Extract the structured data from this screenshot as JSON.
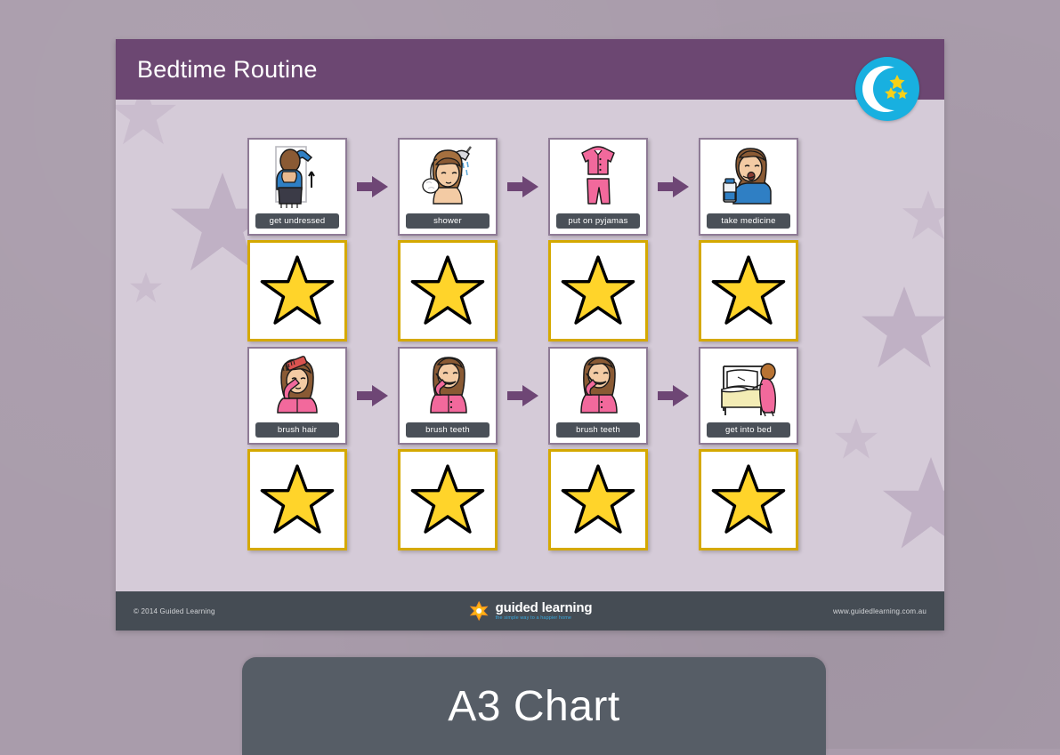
{
  "page": {
    "background_color": "#a99cab"
  },
  "chart": {
    "header": {
      "title": "Bedtime Routine",
      "background_color": "#6c4772",
      "badge_icon": "moon-stars-icon",
      "badge_color": "#18b0e0"
    },
    "background_color": "#d5cbd8",
    "steps": [
      {
        "row": 1,
        "label": "get undressed",
        "art": "girl-getting-undressed",
        "reward": "gold-star"
      },
      {
        "row": 1,
        "label": "shower",
        "art": "girl-in-shower",
        "reward": "gold-star"
      },
      {
        "row": 1,
        "label": "put on pyjamas",
        "art": "pink-pyjamas",
        "reward": "gold-star"
      },
      {
        "row": 1,
        "label": "take medicine",
        "art": "girl-taking-medicine",
        "reward": "gold-star"
      },
      {
        "row": 2,
        "label": "brush hair",
        "art": "girl-brushing-hair",
        "reward": "gold-star"
      },
      {
        "row": 2,
        "label": "brush teeth",
        "art": "girl-brushing-teeth",
        "reward": "gold-star"
      },
      {
        "row": 2,
        "label": "brush teeth",
        "art": "girl-brushing-teeth",
        "reward": "gold-star"
      },
      {
        "row": 2,
        "label": "get into bed",
        "art": "girl-getting-into-bed",
        "reward": "gold-star"
      }
    ],
    "arrow_icon": "right-arrow-icon",
    "arrow_color": "#6e4675",
    "star_color": "#ffd42a",
    "star_card_border_color": "#d5a900",
    "footer": {
      "copyright": "© 2014 Guided Learning",
      "brand_name": "guided learning",
      "brand_tagline": "the simple way to a happier home",
      "brand_mark_icon": "star-flower-logo-icon",
      "url": "www.guidedlearning.com.au",
      "background_color": "#454c54"
    }
  },
  "caption": {
    "label": "A3 Chart",
    "background_color": "#565d66"
  }
}
